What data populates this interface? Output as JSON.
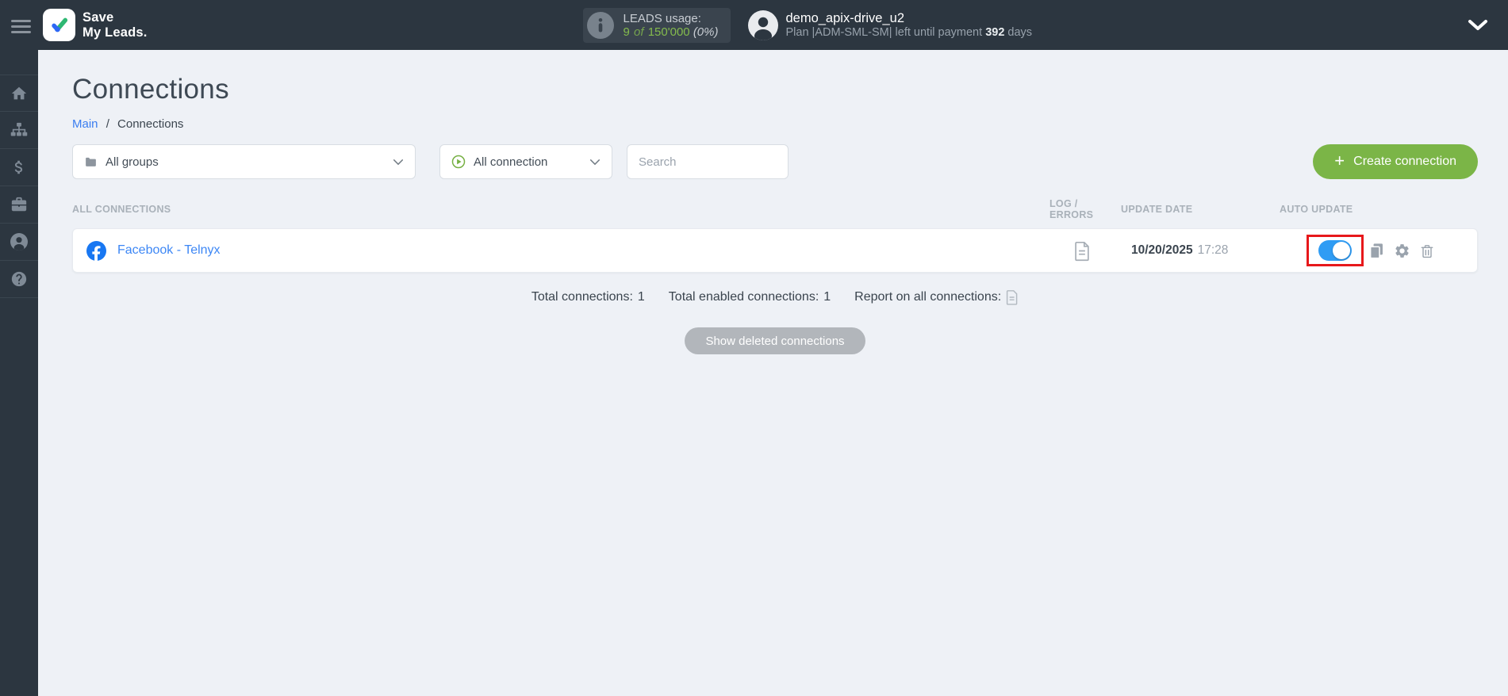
{
  "app": {
    "name_line1": "Save",
    "name_line2": "My Leads."
  },
  "header": {
    "leads_usage": {
      "label": "LEADS usage:",
      "used": "9",
      "of_word": "of",
      "total": "150'000",
      "percent": "(0%)"
    },
    "account": {
      "username": "demo_apix-drive_u2",
      "plan_text": "Plan |ADM-SML-SM| left until payment",
      "days_value": "392",
      "days_word": "days"
    }
  },
  "sidebar": {
    "items": [
      {
        "id": "home",
        "icon": "home-icon"
      },
      {
        "id": "connections",
        "icon": "sitemap-icon"
      },
      {
        "id": "billing",
        "icon": "dollar-icon"
      },
      {
        "id": "services",
        "icon": "briefcase-icon"
      },
      {
        "id": "profile",
        "icon": "user-icon"
      },
      {
        "id": "help",
        "icon": "question-icon"
      }
    ]
  },
  "page": {
    "title": "Connections",
    "breadcrumb": {
      "root": "Main",
      "separator": "/",
      "current": "Connections"
    }
  },
  "filters": {
    "groups": {
      "value": "All groups",
      "icon": "folder-icon"
    },
    "connection_type": {
      "value": "All connection",
      "icon": "play-circle-icon"
    },
    "search": {
      "placeholder": "Search"
    }
  },
  "actions": {
    "create_connection": "Create connection"
  },
  "icons": {
    "plus": "+",
    "hamburger": "menu",
    "chevron_down": "chevron-down",
    "copy": "copy",
    "gear": "settings",
    "trash": "delete",
    "log_document": "file",
    "report_document": "file"
  },
  "table": {
    "headers": {
      "name": "ALL CONNECTIONS",
      "log": "LOG / ERRORS",
      "update_date": "UPDATE DATE",
      "auto_update": "AUTO UPDATE"
    },
    "rows": [
      {
        "name": "Facebook - Telnyx",
        "service_icon": "facebook-icon",
        "update_date": "10/20/2025",
        "update_time": "17:28",
        "auto_update_enabled": true,
        "highlighted": true
      }
    ]
  },
  "summary": {
    "total_label": "Total connections:",
    "total_value": "1",
    "enabled_label": "Total enabled connections:",
    "enabled_value": "1",
    "report_label": "Report on all connections:"
  },
  "footer_actions": {
    "show_deleted": "Show deleted connections"
  },
  "colors": {
    "header_bg": "#2c3640",
    "main_bg": "#eef1f6",
    "accent_green": "#7bb547",
    "leads_green": "#84bb4d",
    "link_blue": "#3d87f5",
    "facebook_blue": "#1877f2",
    "toggle_blue": "#2f9cf4",
    "highlight_red": "#e7181b"
  }
}
